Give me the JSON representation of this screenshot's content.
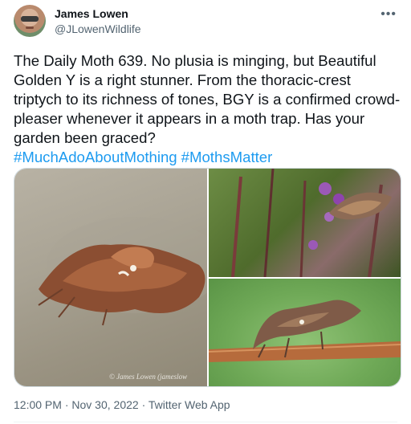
{
  "author": {
    "name": "James Lowen",
    "handle": "@JLowenWildlife"
  },
  "tweet": {
    "text": "The Daily Moth 639. No plusia is minging, but Beautiful Golden Y is a right stunner. From the thoracic-crest triptych to its richness of tones, BGY is a confirmed crowd-pleaser whenever it appears in a moth trap. Has your garden been graced?",
    "hashtags": [
      "#MuchAdoAboutMothing",
      "#MothsMatter"
    ]
  },
  "media": {
    "photo_credit": "© James Lowen (jameslow"
  },
  "meta": {
    "time": "12:00 PM",
    "separator1": " · ",
    "date": "Nov 30, 2022",
    "separator2": " · ",
    "source": "Twitter Web App"
  },
  "icons": {
    "more": "more-options-icon"
  }
}
